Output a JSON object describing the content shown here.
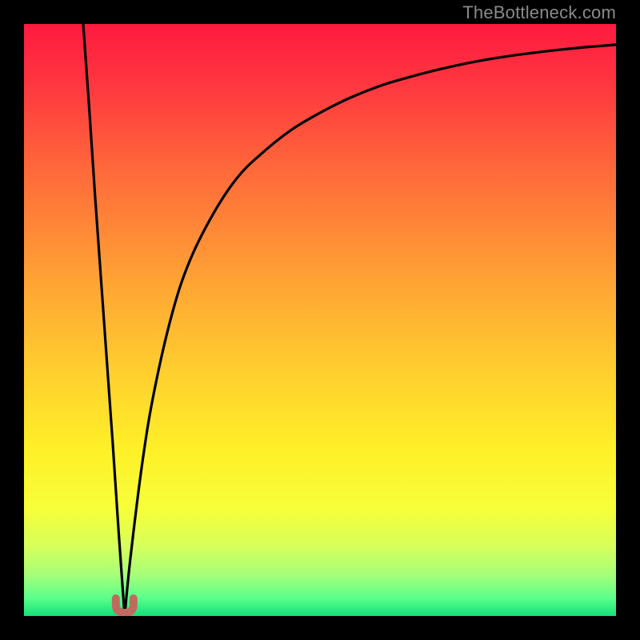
{
  "watermark": "TheBottleneck.com",
  "chart_data": {
    "type": "line",
    "title": "",
    "xlabel": "",
    "ylabel": "",
    "xlim": [
      0,
      100
    ],
    "ylim": [
      0,
      100
    ],
    "grid": false,
    "legend": false,
    "notes": "Heat-map style gradient background from red (top) through orange/yellow to green (bottom). Two black curves both reaching a minimum near x≈17, y≈0 with a small red U-shaped marker at the cusp.",
    "series": [
      {
        "name": "left-branch",
        "x": [
          10,
          11,
          12,
          13,
          14,
          15,
          16,
          17
        ],
        "y": [
          100,
          86,
          71,
          57,
          43,
          29,
          14,
          0
        ]
      },
      {
        "name": "right-branch",
        "x": [
          17,
          18,
          20,
          22,
          25,
          28,
          32,
          36,
          40,
          45,
          50,
          55,
          60,
          65,
          70,
          75,
          80,
          85,
          90,
          95,
          100
        ],
        "y": [
          0,
          10,
          26,
          38,
          51,
          60,
          68,
          74,
          78,
          82,
          85,
          87.5,
          89.5,
          91,
          92.3,
          93.4,
          94.3,
          95,
          95.6,
          96.1,
          96.5
        ]
      }
    ],
    "cusp_marker": {
      "x": 17,
      "y": 0,
      "shape": "U",
      "color": "#c06a5f"
    },
    "gradient_stops": [
      {
        "pos": 0.0,
        "color": "#ff1a3f"
      },
      {
        "pos": 0.1,
        "color": "#ff3640"
      },
      {
        "pos": 0.25,
        "color": "#ff6a3a"
      },
      {
        "pos": 0.45,
        "color": "#ffa834"
      },
      {
        "pos": 0.6,
        "color": "#ffd22e"
      },
      {
        "pos": 0.72,
        "color": "#fff028"
      },
      {
        "pos": 0.82,
        "color": "#f6ff3a"
      },
      {
        "pos": 0.88,
        "color": "#d8ff5a"
      },
      {
        "pos": 0.93,
        "color": "#a6ff78"
      },
      {
        "pos": 0.97,
        "color": "#5aff8c"
      },
      {
        "pos": 1.0,
        "color": "#12e07a"
      }
    ]
  }
}
